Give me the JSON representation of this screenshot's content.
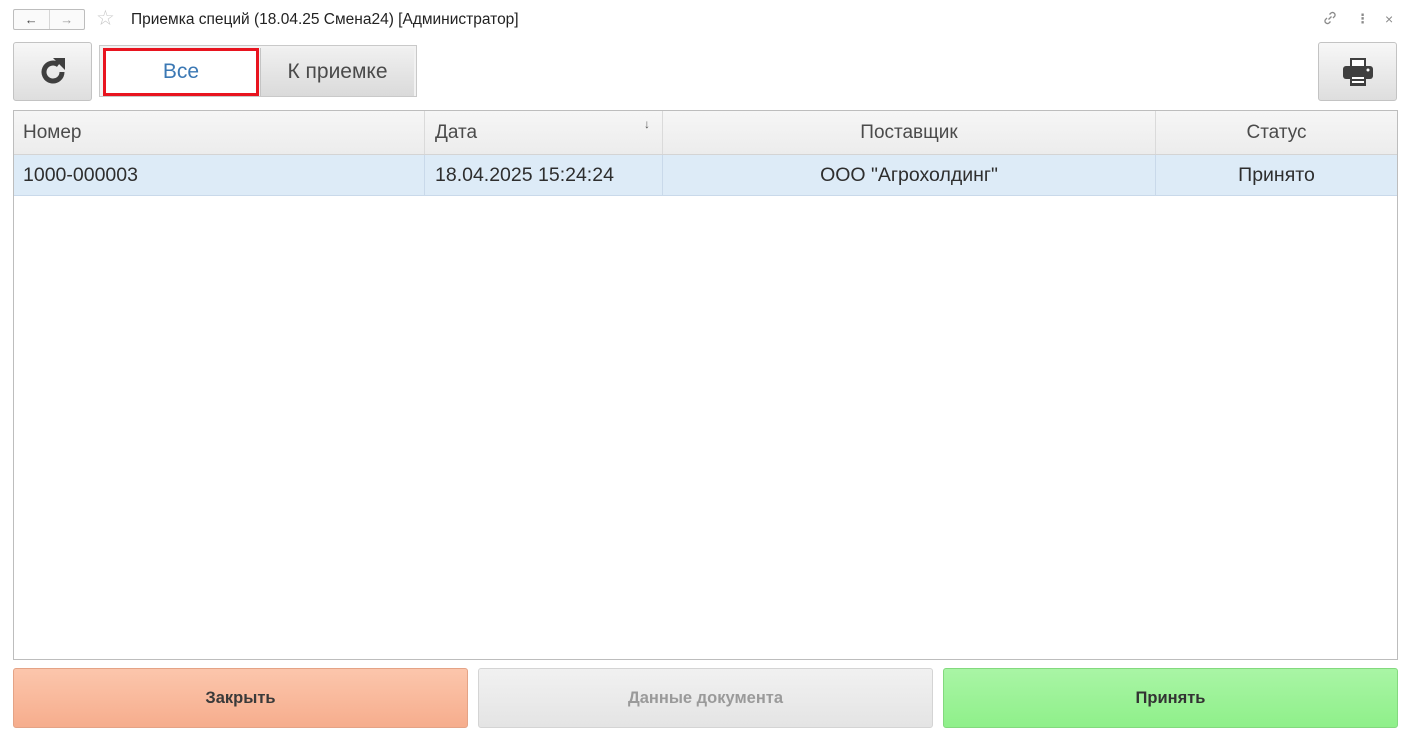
{
  "window": {
    "title": "Приемка специй (18.04.25 Смена24) [Администратор]",
    "back_glyph": "←",
    "forward_glyph": "→",
    "star_glyph": "☆",
    "link_glyph": "🔗",
    "more_glyph": "⋮",
    "close_glyph": "×"
  },
  "toolbar": {
    "refresh_icon": "refresh-icon",
    "print_icon": "printer-icon",
    "tabs": [
      {
        "label": "Все",
        "selected": true
      },
      {
        "label": "К приемке",
        "selected": false
      }
    ]
  },
  "table": {
    "columns": [
      "Номер",
      "Дата",
      "Поставщик",
      "Статус"
    ],
    "sort_indicator": "↓",
    "rows": [
      {
        "number": "1000-000003",
        "date": "18.04.2025 15:24:24",
        "supplier": "ООО \"Агрохолдинг\"",
        "status": "Принято"
      }
    ]
  },
  "actions": {
    "close_label": "Закрыть",
    "doc_data_label": "Данные документа",
    "accept_label": "Принять"
  },
  "colors": {
    "selected_tab_border": "#e8141f",
    "selected_tab_text": "#3b78b4",
    "row_highlight": "#ddebf7",
    "close_button": "#f6ad8d",
    "accept_button": "#8ff08a"
  }
}
